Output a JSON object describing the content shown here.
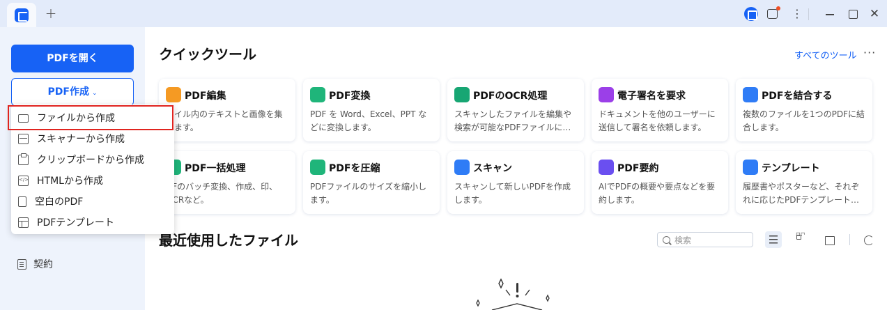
{
  "window": {
    "new_tab_label": "+",
    "more_label": "⋮",
    "close_label": "✕"
  },
  "sidebar": {
    "open_pdf_label": "PDFを開く",
    "create_pdf_label": "PDF作成",
    "create_chevron": "⌄",
    "contract_label": "契約"
  },
  "create_menu": {
    "items": [
      {
        "label": "ファイルから作成",
        "icon": "folder-icon"
      },
      {
        "label": "スキャナーから作成",
        "icon": "scanner-icon"
      },
      {
        "label": "クリップボードから作成",
        "icon": "clipboard-icon"
      },
      {
        "label": "HTMLから作成",
        "icon": "html-icon"
      },
      {
        "label": "空白のPDF",
        "icon": "blank-page-icon"
      },
      {
        "label": "PDFテンプレート",
        "icon": "template-icon"
      }
    ],
    "highlight_color": "#e0241f"
  },
  "quick_tools": {
    "title": "クイックツール",
    "all_tools_label": "すべてのツール",
    "more_label": "···",
    "cards": [
      {
        "title": "PDF編集",
        "desc": "ァイル内のテキストと画像を集します。",
        "icon": "edit-icon",
        "color": "#f59a23"
      },
      {
        "title": "PDF変換",
        "desc": "PDF を Word、Excel、PPT などに変換します。",
        "icon": "convert-icon",
        "color": "#1fb57a"
      },
      {
        "title": "PDFのOCR処理",
        "desc": "スキャンしたファイルを編集や検索が可能なPDFファイルに…",
        "icon": "ocr-icon",
        "color": "#17a673"
      },
      {
        "title": "電子署名を要求",
        "desc": "ドキュメントを他のユーザーに送信して署名を依頼します。",
        "icon": "signature-icon",
        "color": "#9b3fe8"
      },
      {
        "title": "PDFを結合する",
        "desc": "複数のファイルを1つのPDFに結合します。",
        "icon": "merge-icon",
        "color": "#2f7cf6"
      },
      {
        "title": "PDF一括処理",
        "desc": "DFのバッチ変換、作成、印、OCRなど。",
        "icon": "batch-icon",
        "color": "#1fb57a"
      },
      {
        "title": "PDFを圧縮",
        "desc": "PDFファイルのサイズを縮小します。",
        "icon": "compress-icon",
        "color": "#1fb57a"
      },
      {
        "title": "スキャン",
        "desc": "スキャンして新しいPDFを作成します。",
        "icon": "scan-icon",
        "color": "#2f7cf6"
      },
      {
        "title": "PDF要約",
        "desc": "AIでPDFの概要や要点などを要約します。",
        "icon": "summary-icon",
        "color": "#6a4ff0"
      },
      {
        "title": "テンプレート",
        "desc": "履歴書やポスターなど、それぞれに応じたPDFテンプレート…",
        "icon": "template-icon",
        "color": "#2f7cf6"
      }
    ]
  },
  "recent": {
    "title": "最近使用したファイル",
    "search_placeholder": "検索"
  }
}
